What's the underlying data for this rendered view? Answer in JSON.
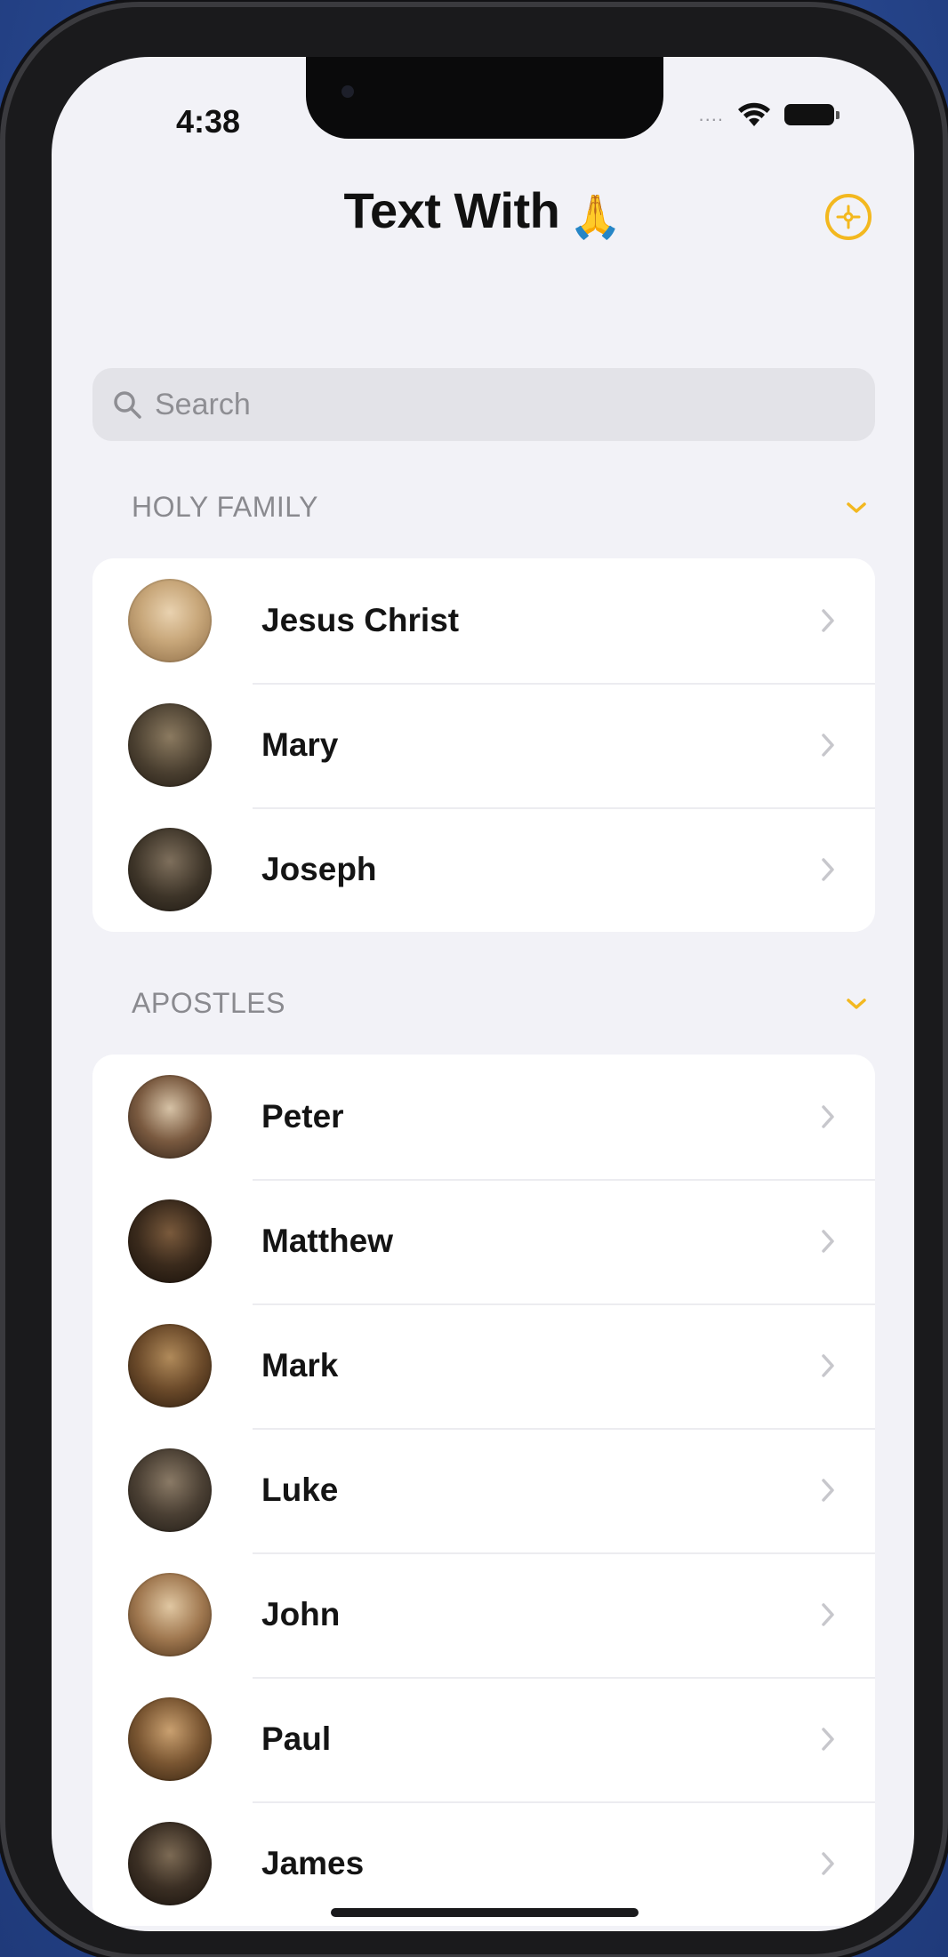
{
  "status_bar": {
    "time": "4:38",
    "signal_dots": "....",
    "wifi_icon": "wifi-icon",
    "battery_icon": "battery-icon"
  },
  "header": {
    "title": "Text With",
    "title_emoji": "🙏",
    "settings_icon": "settings-icon"
  },
  "search": {
    "placeholder": "Search"
  },
  "sections": [
    {
      "title": "HOLY FAMILY",
      "collapse_icon": "chevron-down-icon",
      "items": [
        {
          "name": "Jesus Christ",
          "avatar_color": "#c8a77a"
        },
        {
          "name": "Mary",
          "avatar_color": "#4a3f30"
        },
        {
          "name": "Joseph",
          "avatar_color": "#3d3428"
        }
      ]
    },
    {
      "title": "APOSTLES",
      "collapse_icon": "chevron-down-icon",
      "items": [
        {
          "name": "Peter",
          "avatar_color": "#7a5a40"
        },
        {
          "name": "Matthew",
          "avatar_color": "#3a2a1c"
        },
        {
          "name": "Mark",
          "avatar_color": "#6b4a2a"
        },
        {
          "name": "Luke",
          "avatar_color": "#4b4034"
        },
        {
          "name": "John",
          "avatar_color": "#a07850"
        },
        {
          "name": "Paul",
          "avatar_color": "#7a5632"
        },
        {
          "name": "James",
          "avatar_color": "#3b2f24"
        }
      ]
    }
  ],
  "colors": {
    "accent": "#f3b81f",
    "background": "#f2f2f7",
    "card": "#ffffff",
    "section_title": "#8a8a8f",
    "chevron": "#c7c7cc"
  }
}
